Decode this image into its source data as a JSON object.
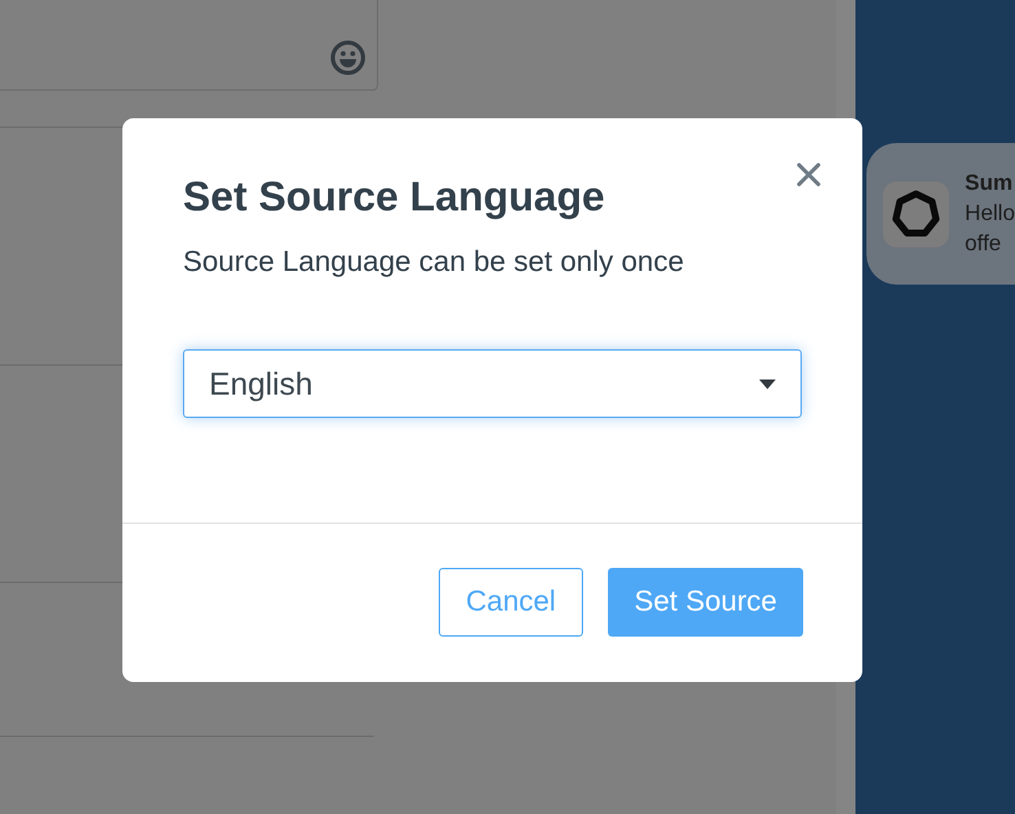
{
  "dialog": {
    "title": "Set Source Language",
    "subtitle": "Source Language can be set only once",
    "language_select": {
      "value": "English"
    },
    "buttons": [
      {
        "label": "Cancel",
        "kind": "secondary"
      },
      {
        "label": "Set Source",
        "kind": "primary"
      }
    ]
  },
  "notification": {
    "title": "Sum",
    "lines": [
      "Hello",
      "offe"
    ]
  }
}
